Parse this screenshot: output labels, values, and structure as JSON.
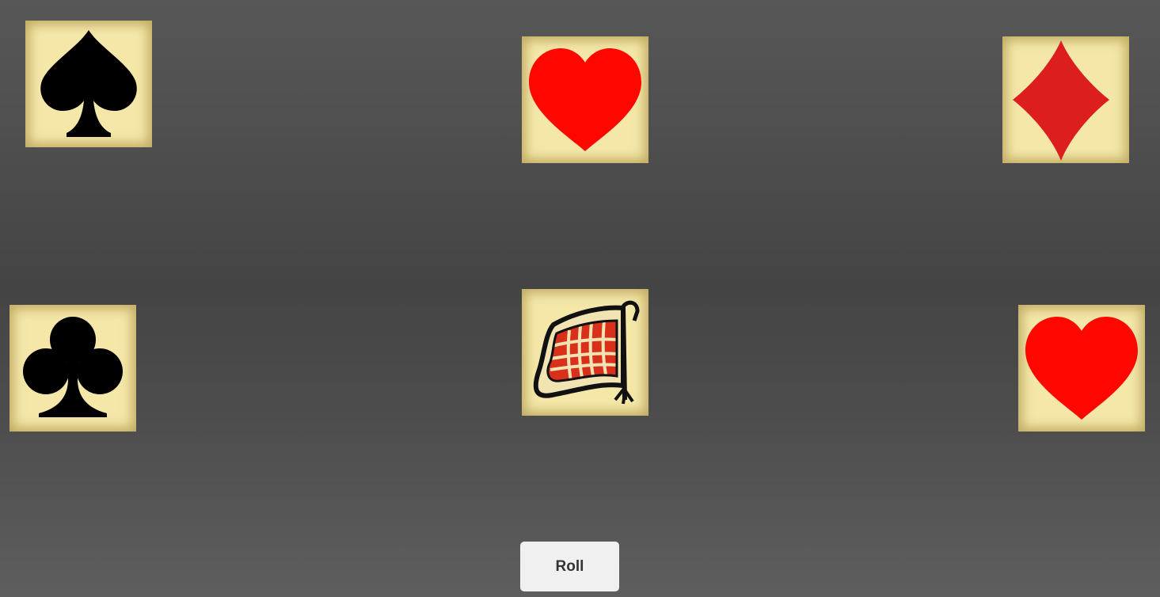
{
  "dice": [
    {
      "face": "spade",
      "icon": "spade-icon",
      "color": "#000000"
    },
    {
      "face": "heart",
      "icon": "heart-icon",
      "color": "#ff0700"
    },
    {
      "face": "diamond",
      "icon": "diamond-icon",
      "color": "#dc1e1e"
    },
    {
      "face": "club",
      "icon": "club-icon",
      "color": "#000000"
    },
    {
      "face": "flag",
      "icon": "flag-icon",
      "color": "#d9301c"
    },
    {
      "face": "heart",
      "icon": "heart-icon",
      "color": "#ff0700"
    }
  ],
  "controls": {
    "roll_label": "Roll"
  },
  "colors": {
    "die_face": "#f4e7a8",
    "button_bg": "#f0f0f0",
    "button_text": "#333333"
  }
}
